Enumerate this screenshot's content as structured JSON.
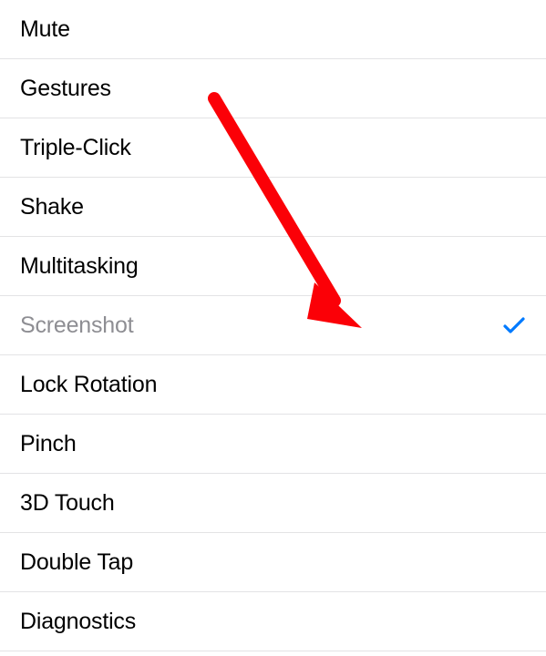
{
  "menu": {
    "items": [
      {
        "label": "Mute",
        "selected": false
      },
      {
        "label": "Gestures",
        "selected": false
      },
      {
        "label": "Triple-Click",
        "selected": false
      },
      {
        "label": "Shake",
        "selected": false
      },
      {
        "label": "Multitasking",
        "selected": false
      },
      {
        "label": "Screenshot",
        "selected": true
      },
      {
        "label": "Lock Rotation",
        "selected": false
      },
      {
        "label": "Pinch",
        "selected": false
      },
      {
        "label": "3D Touch",
        "selected": false
      },
      {
        "label": "Double Tap",
        "selected": false
      },
      {
        "label": "Diagnostics",
        "selected": false
      }
    ]
  },
  "colors": {
    "accent": "#007aff",
    "separator": "#e3e3e5",
    "text": "#000000",
    "selectedText": "#8e8e93",
    "annotation": "#fb0007"
  }
}
